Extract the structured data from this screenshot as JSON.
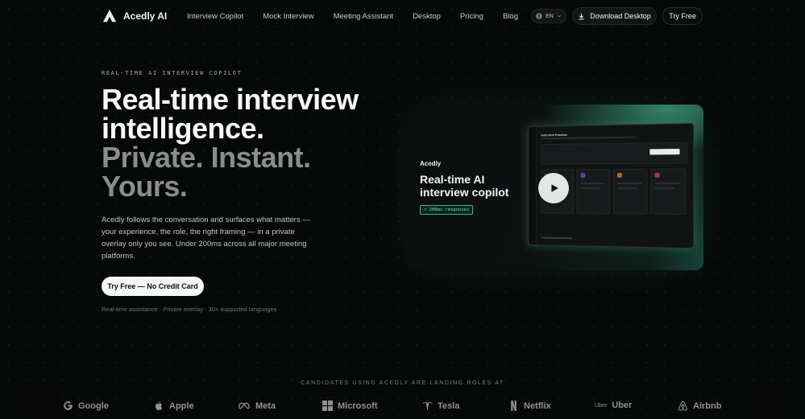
{
  "brand": {
    "name": "Acedly AI"
  },
  "nav": {
    "links": [
      "Interview Copilot",
      "Mock Interview",
      "Meeting Assistant",
      "Desktop",
      "Pricing",
      "Blog"
    ],
    "language": "EN",
    "download_label": "Download Desktop",
    "try_label": "Try Free"
  },
  "hero": {
    "eyebrow": "REAL-TIME AI INTERVIEW COPILOT",
    "line1": "Real-time interview",
    "line2": "intelligence.",
    "line3": "Private. Instant.",
    "line4": "Yours.",
    "lead": "Acedly follows the conversation and surfaces what matters — your experience, the role, the right framing — in a private overlay only you see. Under 200ms across all major meeting platforms.",
    "cta_label": "Try Free — No Credit Card",
    "meta": "Real-time assistance · Private overlay · 30+ supported languages"
  },
  "video": {
    "brand": "Acedly",
    "title": "Real-time AI interview copilot",
    "badge": "< 200ms responses",
    "screen_title": "Interview Practice"
  },
  "social": {
    "heading": "CANDIDATES USING ACEDLY ARE LANDING ROLES AT",
    "logos": [
      {
        "name": "Google",
        "icon": "google-icon"
      },
      {
        "name": "Apple",
        "icon": "apple-icon"
      },
      {
        "name": "Meta",
        "icon": "meta-icon"
      },
      {
        "name": "Microsoft",
        "icon": "microsoft-icon"
      },
      {
        "name": "Tesla",
        "icon": "tesla-icon"
      },
      {
        "name": "Netflix",
        "icon": "netflix-icon"
      },
      {
        "name": "Uber",
        "icon": "uber-icon"
      },
      {
        "name": "Airbnb",
        "icon": "airbnb-icon"
      }
    ]
  },
  "colors": {
    "background": "#070808",
    "accent": "#2fb88a",
    "cta_bg": "#f5f6f6"
  }
}
